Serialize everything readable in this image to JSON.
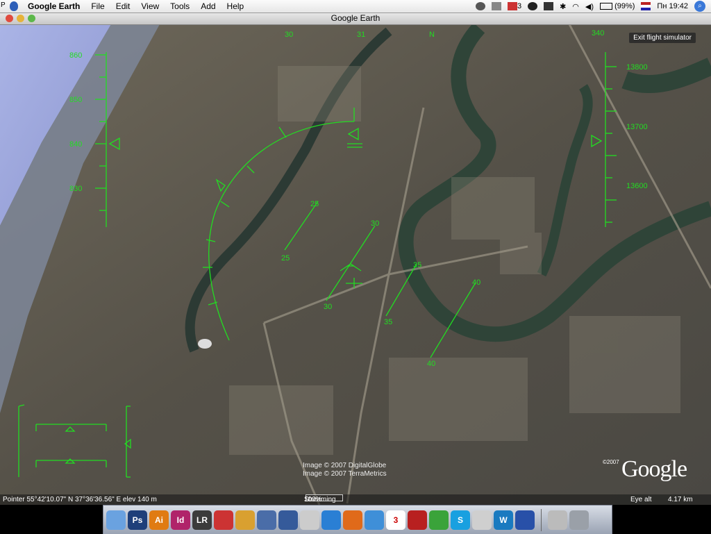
{
  "menubar": {
    "left_mark": "P",
    "app_name": "Google Earth",
    "items": [
      "File",
      "Edit",
      "View",
      "Tools",
      "Add",
      "Help"
    ],
    "mail_count": "3",
    "battery": "(99%)",
    "clock": "Пн 19:42"
  },
  "window": {
    "title": "Google Earth"
  },
  "hud": {
    "exit_label": "Exit flight simulator",
    "heading_ticks": [
      "30",
      "31",
      "N",
      "340"
    ],
    "altitude_labels": [
      "860",
      "850",
      "840",
      "830"
    ],
    "speed_labels": [
      "13800",
      "13700",
      "13600"
    ],
    "pitch_labels": [
      {
        "left": "25",
        "right": "25"
      },
      {
        "left": "30",
        "right": "30"
      },
      {
        "left": "35",
        "right": "35"
      },
      {
        "left": "40",
        "right": "40"
      }
    ]
  },
  "imagery": {
    "credit_1": "Image © 2007 DigitalGlobe",
    "credit_2": "Image © 2007 TerraMetrics",
    "copyright_year": "©2007",
    "logo": "Google"
  },
  "statusbar": {
    "pointer": "Pointer  55°42'10.07\" N   37°36'36.56\" E elev    140 m",
    "streaming_label": "Streaming",
    "streaming_pct": "100%",
    "eye_alt_label": "Eye alt",
    "eye_alt_value": "4.17 km"
  },
  "dock": {
    "items": [
      {
        "name": "finder",
        "label": "",
        "color": "#6aa2e0"
      },
      {
        "name": "photoshop",
        "label": "Ps",
        "color": "#1e3f7a"
      },
      {
        "name": "illustrator",
        "label": "Ai",
        "color": "#e07b12"
      },
      {
        "name": "indesign",
        "label": "Id",
        "color": "#b0246a"
      },
      {
        "name": "lightroom",
        "label": "LR",
        "color": "#3b3b3b"
      },
      {
        "name": "app-6",
        "label": "",
        "color": "#c33"
      },
      {
        "name": "app-7",
        "label": "",
        "color": "#d9a030"
      },
      {
        "name": "app-8",
        "label": "",
        "color": "#4a6da8"
      },
      {
        "name": "iphoto",
        "label": "",
        "color": "#355a9a"
      },
      {
        "name": "preview",
        "label": "",
        "color": "#cccccc"
      },
      {
        "name": "safari",
        "label": "",
        "color": "#2a7fd4"
      },
      {
        "name": "firefox",
        "label": "",
        "color": "#e06a1a"
      },
      {
        "name": "itunes",
        "label": "",
        "color": "#3f8fd8"
      },
      {
        "name": "ical",
        "label": "3",
        "color": "#ffffff"
      },
      {
        "name": "app-15",
        "label": "",
        "color": "#b82020"
      },
      {
        "name": "icq",
        "label": "",
        "color": "#3aa33a"
      },
      {
        "name": "skype",
        "label": "S",
        "color": "#19a0e0"
      },
      {
        "name": "app-18",
        "label": "",
        "color": "#cfcfcf"
      },
      {
        "name": "app-19",
        "label": "W",
        "color": "#1a7ac0"
      },
      {
        "name": "google-earth",
        "label": "",
        "color": "#2850a8"
      }
    ],
    "trailing": [
      {
        "name": "downloads",
        "label": "",
        "color": "#bbbbbb"
      },
      {
        "name": "trash",
        "label": "",
        "color": "#9aa0a8"
      }
    ]
  }
}
